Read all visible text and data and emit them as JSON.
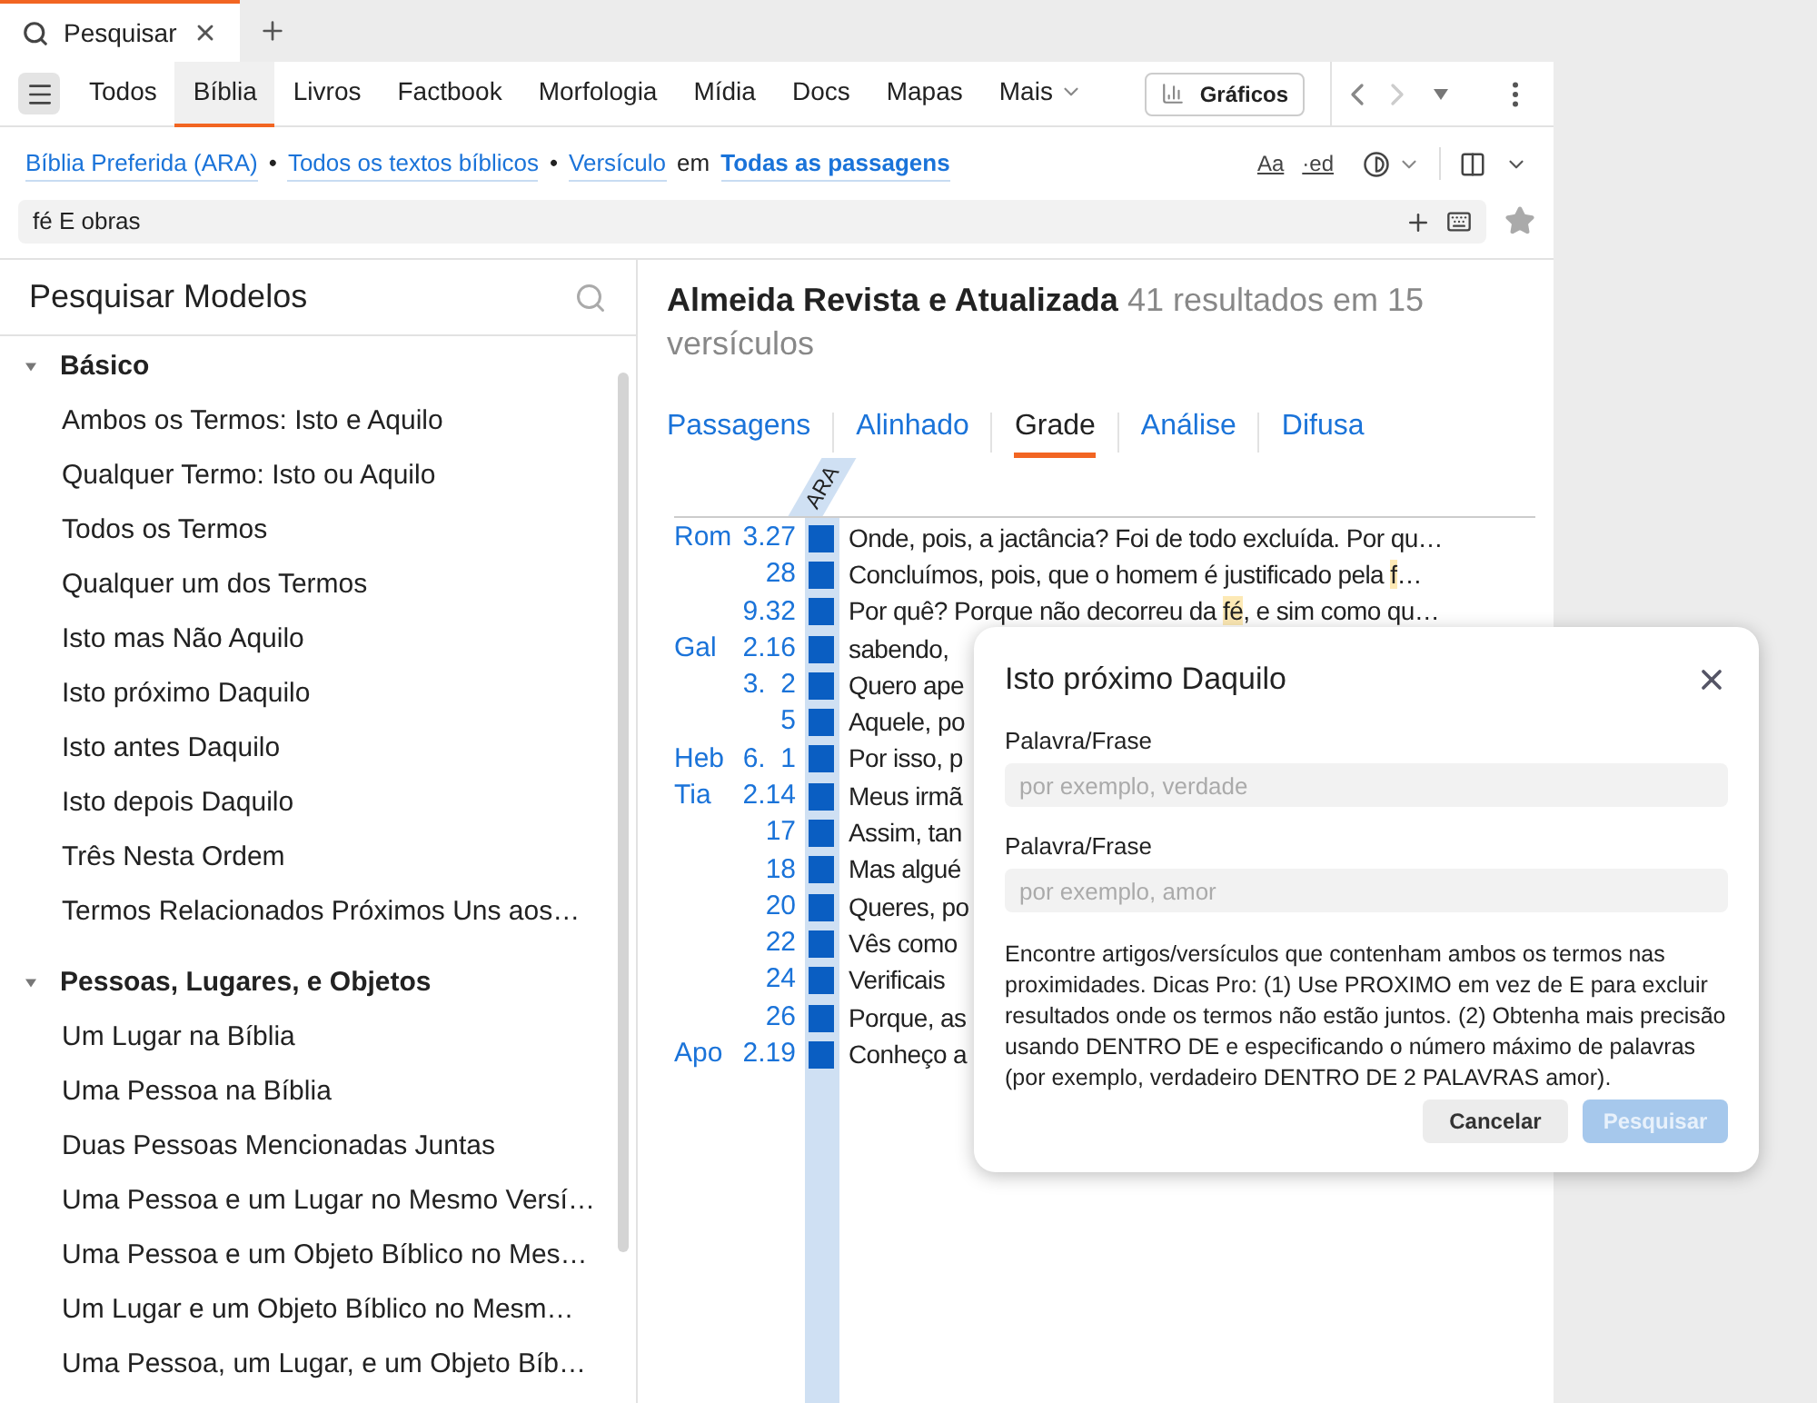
{
  "tab": {
    "label": "Pesquisar"
  },
  "nav": {
    "items": [
      {
        "label": "Todos",
        "selected": false
      },
      {
        "label": "Bíblia",
        "selected": true
      },
      {
        "label": "Livros",
        "selected": false
      },
      {
        "label": "Factbook",
        "selected": false
      },
      {
        "label": "Morfologia",
        "selected": false
      },
      {
        "label": "Mídia",
        "selected": false
      },
      {
        "label": "Docs",
        "selected": false
      },
      {
        "label": "Mapas",
        "selected": false
      },
      {
        "label": "Mais",
        "selected": false,
        "has_menu": true
      }
    ],
    "charts_button": "Gráficos"
  },
  "scope": {
    "parts": [
      {
        "kind": "link",
        "text": "Bíblia Preferida (ARA)"
      },
      {
        "kind": "sep",
        "text": "•"
      },
      {
        "kind": "link",
        "text": "Todos os textos bíblicos"
      },
      {
        "kind": "sep",
        "text": "•"
      },
      {
        "kind": "link",
        "text": "Versículo"
      },
      {
        "kind": "text",
        "text": "em"
      },
      {
        "kind": "strong-link",
        "text": "Todas as passagens"
      }
    ],
    "tools": [
      "Aa",
      "·ed"
    ]
  },
  "search": {
    "value": "fé E obras"
  },
  "sidebar": {
    "title": "Pesquisar Modelos",
    "groups": [
      {
        "label": "Básico",
        "expanded": true,
        "items": [
          "Ambos os Termos: Isto e Aquilo",
          "Qualquer Termo: Isto ou Aquilo",
          "Todos os Termos",
          "Qualquer um dos Termos",
          "Isto mas Não Aquilo",
          "Isto próximo Daquilo",
          "Isto antes Daquilo",
          "Isto depois Daquilo",
          "Três Nesta Ordem",
          "Termos Relacionados Próximos Uns aos…"
        ]
      },
      {
        "label": "Pessoas, Lugares, e Objetos",
        "expanded": true,
        "items": [
          "Um Lugar na Bíblia",
          "Uma Pessoa na Bíblia",
          "Duas Pessoas Mencionadas Juntas",
          "Uma Pessoa e um Lugar no Mesmo Versí…",
          "Uma Pessoa e um Objeto Bíblico no Mes…",
          "Um Lugar e um Objeto Bíblico no Mesm…",
          "Uma Pessoa, um Lugar, e um Objeto Bíb…"
        ]
      }
    ]
  },
  "results": {
    "title": "Almeida Revista e Atualizada",
    "summary": "41 resultados em 15 versículos",
    "views": [
      {
        "label": "Passagens",
        "selected": false
      },
      {
        "label": "Alinhado",
        "selected": false
      },
      {
        "label": "Grade",
        "selected": true
      },
      {
        "label": "Análise",
        "selected": false
      },
      {
        "label": "Difusa",
        "selected": false
      }
    ],
    "column": "ARA",
    "rows": [
      {
        "book": "Rom",
        "ref": "3.27",
        "segments": [
          {
            "text": "Onde, pois, a jactância? Foi de todo excluída. Por qu…",
            "hit": false
          }
        ]
      },
      {
        "ref": "28",
        "segments": [
          {
            "text": "Concluímos, pois, que o homem é justificado pela ",
            "hit": false
          },
          {
            "text": "f",
            "hit": true
          },
          {
            "text": "…",
            "hit": false
          }
        ]
      },
      {
        "ref": "9.32",
        "segments": [
          {
            "text": "Por quê? Porque não decorreu da ",
            "hit": false
          },
          {
            "text": "fé",
            "hit": true
          },
          {
            "text": ", e sim como qu…",
            "hit": false
          }
        ]
      },
      {
        "book": "Gal",
        "ref": "2.16",
        "segments": [
          {
            "text": "sabendo,",
            "hit": false
          }
        ]
      },
      {
        "ref": "3.  2",
        "segments": [
          {
            "text": "Quero ape",
            "hit": false
          }
        ]
      },
      {
        "ref": "5",
        "segments": [
          {
            "text": "Aquele, po",
            "hit": false
          }
        ]
      },
      {
        "book": "Heb",
        "ref": "6.  1",
        "segments": [
          {
            "text": "Por isso, p",
            "hit": false
          }
        ]
      },
      {
        "book": "Tia",
        "ref": "2.14",
        "segments": [
          {
            "text": "Meus irmã",
            "hit": false
          }
        ]
      },
      {
        "ref": "17",
        "segments": [
          {
            "text": "Assim, tan",
            "hit": false
          }
        ]
      },
      {
        "ref": "18",
        "segments": [
          {
            "text": "Mas algué",
            "hit": false
          }
        ]
      },
      {
        "ref": "20",
        "segments": [
          {
            "text": "Queres, po",
            "hit": false
          }
        ]
      },
      {
        "ref": "22",
        "segments": [
          {
            "text": "Vês como",
            "hit": false
          }
        ]
      },
      {
        "ref": "24",
        "segments": [
          {
            "text": "Verificais",
            "hit": false
          }
        ]
      },
      {
        "ref": "26",
        "segments": [
          {
            "text": "Porque, as",
            "hit": false
          }
        ]
      },
      {
        "book": "Apo",
        "ref": "2.19",
        "segments": [
          {
            "text": "Conheço a",
            "hit": false
          }
        ]
      }
    ]
  },
  "dialog": {
    "title": "Isto próximo Daquilo",
    "fields": [
      {
        "label": "Palavra/Frase",
        "placeholder": "por exemplo, verdade"
      },
      {
        "label": "Palavra/Frase",
        "placeholder": "por exemplo, amor"
      }
    ],
    "description": "Encontre artigos/versículos que contenham ambos os termos nas proximidades. Dicas Pro: (1) Use PROXIMO em vez de E para excluir resultados onde os termos não estão juntos. (2) Obtenha mais precisão usando DENTRO DE e especificando o número máximo de palavras (por exemplo, verdadeiro DENTRO DE 2 PALAVRAS amor).",
    "buttons": [
      {
        "label": "Cancelar",
        "kind": "secondary",
        "disabled": false
      },
      {
        "label": "Pesquisar",
        "kind": "primary",
        "disabled": true
      }
    ]
  }
}
